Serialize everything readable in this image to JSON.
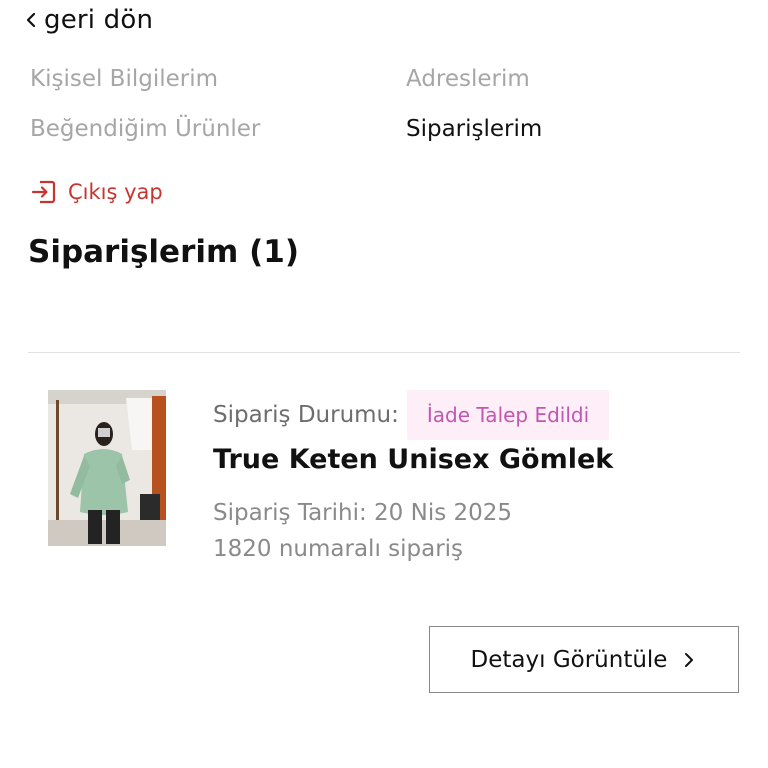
{
  "header": {
    "back_label": "geri dön",
    "back_icon": "chevron-left-icon"
  },
  "account_nav": {
    "personal_info": "Kişisel Bilgilerim",
    "addresses": "Adreslerim",
    "favorites": "Beğendiğim Ürünler",
    "orders": "Siparişlerim",
    "active": "orders"
  },
  "logout": {
    "label": "Çıkış yap",
    "icon": "logout-icon",
    "color": "#c7352f"
  },
  "page": {
    "title": "Siparişlerim (1)"
  },
  "orders": [
    {
      "image_icon": "product-photo",
      "status_label": "Sipariş Durumu:",
      "status_value": "İade Talep Edildi",
      "status_color": "#c256b0",
      "status_bg": "#fdeef8",
      "product_name": "True Keten Unisex Gömlek",
      "order_date": "Sipariş Tarihi: 20 Nis 2025",
      "order_number": "1820 numaralı sipariş",
      "detail_button": "Detayı Görüntüle",
      "detail_icon": "chevron-right-icon"
    }
  ]
}
